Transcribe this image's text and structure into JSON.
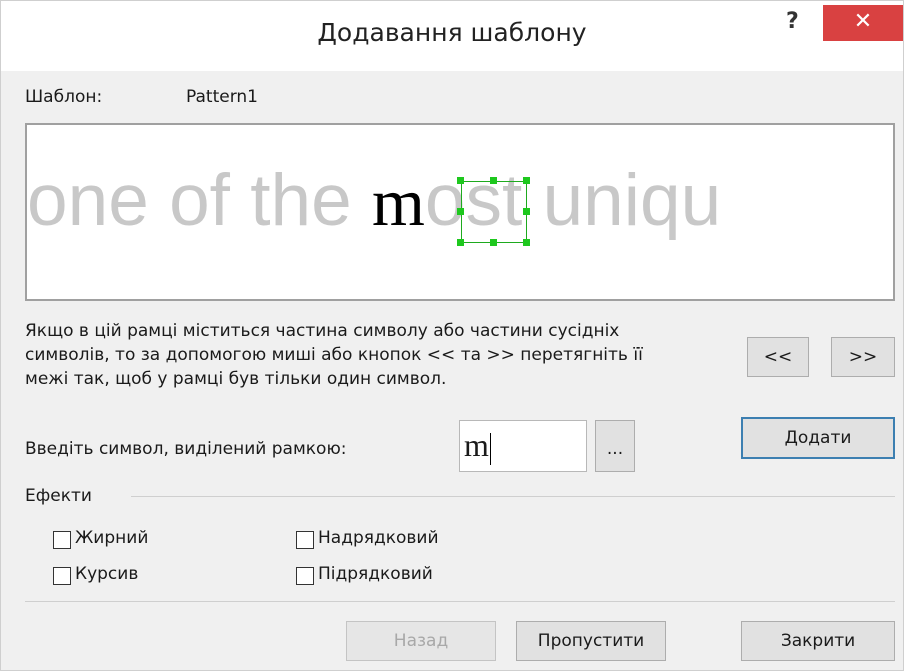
{
  "window": {
    "title": "Додавання шаблону",
    "help_label": "?",
    "close_label": "✕"
  },
  "template": {
    "label": "Шаблон:",
    "value": "Pattern1"
  },
  "preview": {
    "before": "one of the ",
    "selected": "m",
    "after": "ost uniqu"
  },
  "instruction": {
    "line1": "Якщо в цій рамці міститься частина символу або частини сусідніх",
    "line2": "символів, то за допомогою миші або кнопок << та >> перетягніть її",
    "line3": "межі так, щоб у рамці був тільки один символ."
  },
  "nav": {
    "prev_label": "<<",
    "next_label": ">>"
  },
  "symbol": {
    "label": "Введіть символ, виділений рамкою:",
    "value": "m",
    "browse_label": "...",
    "add_label": "Додати"
  },
  "effects": {
    "group_label": "Ефекти",
    "bold_label": "Жирний",
    "bold_checked": false,
    "italic_label": "Курсив",
    "italic_checked": false,
    "superscript_label": "Надрядковий",
    "superscript_checked": false,
    "subscript_label": "Підрядковий",
    "subscript_checked": false
  },
  "footer": {
    "back_label": "Назад",
    "back_disabled": true,
    "skip_label": "Пропустити",
    "close_label": "Закрити"
  },
  "colors": {
    "close_button": "#d94141",
    "selection_frame": "#1eaa1e",
    "preview_text": "#c8c8c8"
  }
}
